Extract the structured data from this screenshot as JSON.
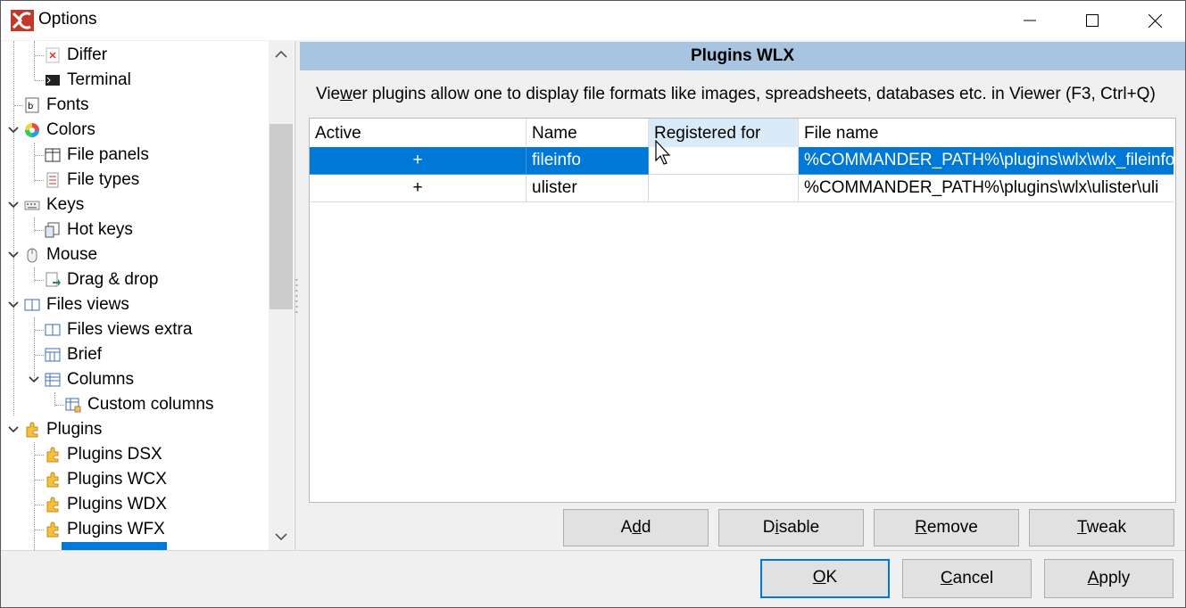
{
  "window": {
    "title": "Options",
    "minimize": "—",
    "maximize": "☐",
    "close": "✕"
  },
  "tree": {
    "items": [
      {
        "label": "Differ",
        "icon": "differ-icon"
      },
      {
        "label": "Terminal",
        "icon": "terminal-icon"
      },
      {
        "label": "Fonts",
        "icon": "fonts-icon"
      },
      {
        "label": "Colors",
        "icon": "colors-icon"
      },
      {
        "label": "File panels",
        "icon": "file-panels-icon"
      },
      {
        "label": "File types",
        "icon": "file-types-icon"
      },
      {
        "label": "Keys",
        "icon": "keys-icon"
      },
      {
        "label": "Hot keys",
        "icon": "hot-keys-icon"
      },
      {
        "label": "Mouse",
        "icon": "mouse-icon"
      },
      {
        "label": "Drag & drop",
        "icon": "drag-drop-icon"
      },
      {
        "label": "Files views",
        "icon": "files-views-icon"
      },
      {
        "label": "Files views extra",
        "icon": "files-views-extra-icon"
      },
      {
        "label": "Brief",
        "icon": "brief-icon"
      },
      {
        "label": "Columns",
        "icon": "columns-icon"
      },
      {
        "label": "Custom columns",
        "icon": "custom-columns-icon"
      },
      {
        "label": "Plugins",
        "icon": "plugin-icon"
      },
      {
        "label": "Plugins DSX",
        "icon": "plugin-icon"
      },
      {
        "label": "Plugins WCX",
        "icon": "plugin-icon"
      },
      {
        "label": "Plugins WDX",
        "icon": "plugin-icon"
      },
      {
        "label": "Plugins WFX",
        "icon": "plugin-icon"
      }
    ]
  },
  "panel": {
    "heading": "Plugins WLX",
    "description_pre": "Vie",
    "description_ul": "w",
    "description_post": "er plugins allow one to display file formats like images, spreadsheets, databases etc. in Viewer (F3, Ctrl+Q)"
  },
  "grid": {
    "columns": [
      "Active",
      "Name",
      "Registered for",
      "File name"
    ],
    "rows": [
      {
        "active": "+",
        "name": "fileinfo",
        "registered": "",
        "file": "%COMMANDER_PATH%\\plugins\\wlx\\wlx_fileinfo",
        "selected": true
      },
      {
        "active": "+",
        "name": "ulister",
        "registered": "",
        "file": "%COMMANDER_PATH%\\plugins\\wlx\\ulister\\uli",
        "selected": false
      }
    ]
  },
  "actions": {
    "add": {
      "pre": "A",
      "ul": "d",
      "post": "d"
    },
    "disable": {
      "pre": "D",
      "ul": "i",
      "post": "sable"
    },
    "remove": {
      "pre": "",
      "ul": "R",
      "post": "emove"
    },
    "tweak": {
      "pre": "",
      "ul": "T",
      "post": "weak"
    }
  },
  "dialog": {
    "ok": {
      "pre": "",
      "ul": "O",
      "post": "K"
    },
    "cancel": {
      "pre": "",
      "ul": "C",
      "post": "ancel"
    },
    "apply": {
      "pre": "",
      "ul": "A",
      "post": "pply"
    }
  },
  "colors": {
    "selection": "#0078d7",
    "header_band": "#a7c4e0",
    "button_face": "#e1e1e1"
  }
}
